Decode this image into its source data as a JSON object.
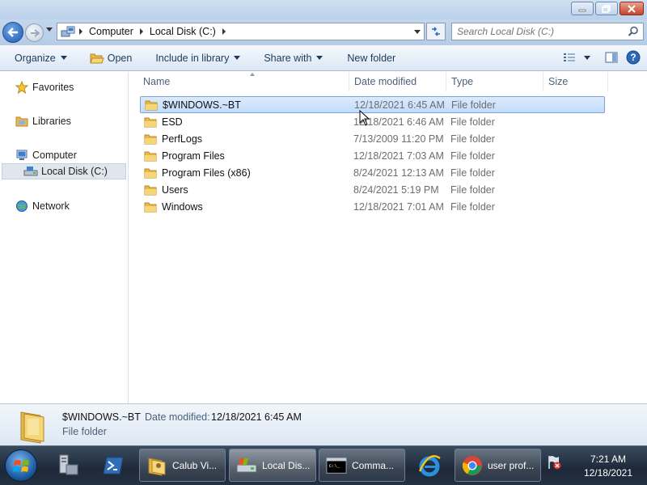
{
  "window": {
    "controls": {
      "minimize_icon": "minimize-icon",
      "maximize_icon": "restore-icon",
      "close_icon": "close-icon"
    }
  },
  "address": {
    "breadcrumbs": [
      "Computer",
      "Local Disk (C:)"
    ],
    "search_placeholder": "Search Local Disk (C:)"
  },
  "toolbar": {
    "organize": "Organize",
    "open": "Open",
    "include_in_library": "Include in library",
    "share_with": "Share with",
    "new_folder": "New folder"
  },
  "navpane": {
    "favorites": "Favorites",
    "libraries": "Libraries",
    "computer": "Computer",
    "local_disk": "Local Disk (C:)",
    "network": "Network"
  },
  "columns": {
    "name": "Name",
    "date_modified": "Date modified",
    "type": "Type",
    "size": "Size"
  },
  "files": [
    {
      "name": "$WINDOWS.~BT",
      "date": "12/18/2021 6:45 AM",
      "type": "File folder",
      "selected": true
    },
    {
      "name": "ESD",
      "date": "12/18/2021 6:46 AM",
      "type": "File folder"
    },
    {
      "name": "PerfLogs",
      "date": "7/13/2009 11:20 PM",
      "type": "File folder"
    },
    {
      "name": "Program Files",
      "date": "12/18/2021 7:03 AM",
      "type": "File folder"
    },
    {
      "name": "Program Files (x86)",
      "date": "8/24/2021 12:13 AM",
      "type": "File folder"
    },
    {
      "name": "Users",
      "date": "8/24/2021 5:19 PM",
      "type": "File folder"
    },
    {
      "name": "Windows",
      "date": "12/18/2021 7:01 AM",
      "type": "File folder"
    }
  ],
  "details": {
    "name": "$WINDOWS.~BT",
    "date_label": "Date modified:",
    "date_value": "12/18/2021 6:45 AM",
    "type": "File folder"
  },
  "taskbar": {
    "tasks": [
      {
        "label": "Calub Vi...",
        "icon": "user-folder-icon"
      },
      {
        "label": "Local Dis...",
        "icon": "drive-icon",
        "active": true
      },
      {
        "label": "Comma...",
        "icon": "cmd-icon"
      },
      {
        "label": "user prof...",
        "icon": "chrome-icon"
      }
    ],
    "time": "7:21 AM",
    "date": "12/18/2021"
  },
  "colors": {
    "selection_bg": "#c2dcfd",
    "selection_border": "#7da2ce",
    "folder_yellow": "#f3cb5a",
    "taskbar": "#1d2838"
  }
}
